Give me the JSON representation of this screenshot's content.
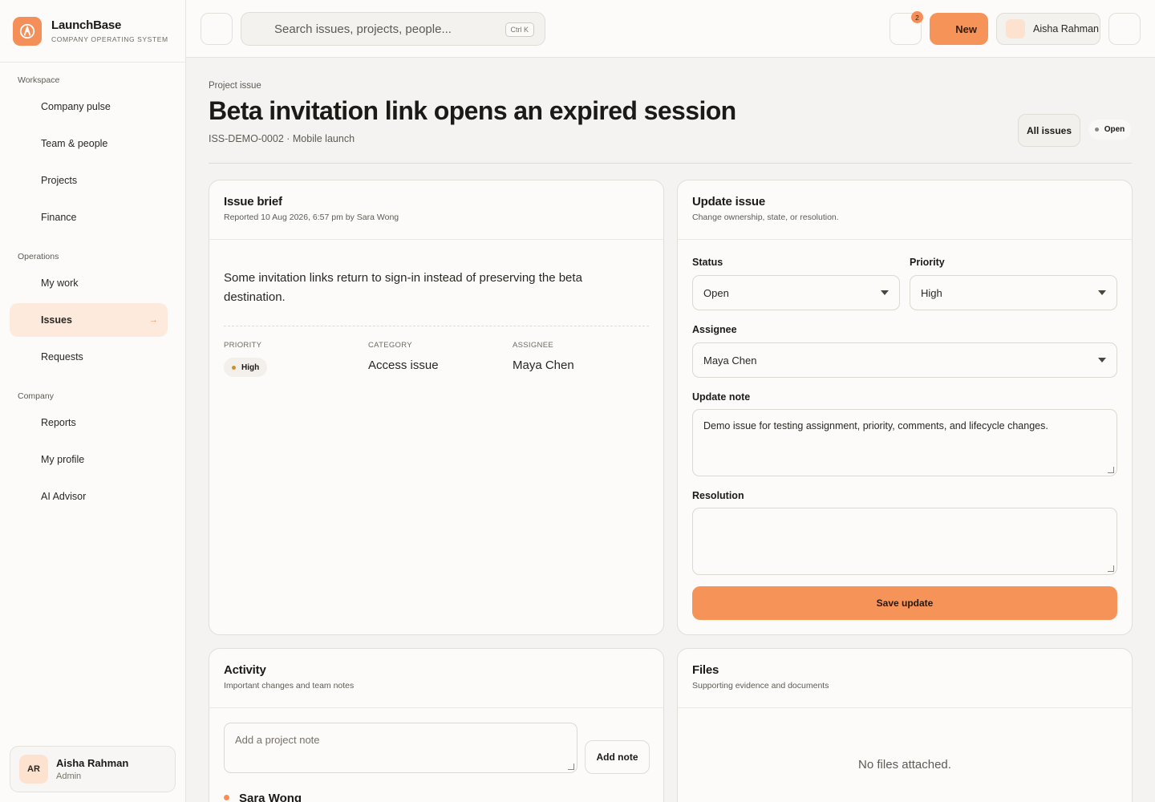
{
  "brand": {
    "name": "LaunchBase",
    "subtitle": "COMPANY OPERATING SYSTEM"
  },
  "sidebar": {
    "sections": [
      {
        "label": "Workspace",
        "items": [
          {
            "label": "Company pulse"
          },
          {
            "label": "Team & people"
          },
          {
            "label": "Projects"
          },
          {
            "label": "Finance"
          }
        ]
      },
      {
        "label": "Operations",
        "items": [
          {
            "label": "My work"
          },
          {
            "label": "Issues",
            "active": true,
            "arrow": "→"
          },
          {
            "label": "Requests"
          }
        ]
      },
      {
        "label": "Company",
        "items": [
          {
            "label": "Reports"
          },
          {
            "label": "My profile"
          },
          {
            "label": "AI Advisor"
          }
        ]
      }
    ],
    "user": {
      "initials": "AR",
      "name": "Aisha Rahman",
      "role": "Admin"
    }
  },
  "topbar": {
    "search_placeholder": "Search issues, projects, people...",
    "search_shortcut": "Ctrl K",
    "notification_count": "2",
    "new_label": "New",
    "user_name": "Aisha Rahman"
  },
  "page": {
    "eyebrow": "Project issue",
    "title": "Beta invitation link opens an expired session",
    "subtitle": "ISS-DEMO-0002 · Mobile launch",
    "all_issues_label": "All issues",
    "status": "Open"
  },
  "brief": {
    "title": "Issue brief",
    "subtitle": "Reported 10 Aug 2026, 6:57 pm by Sara Wong",
    "description": "Some invitation links return to sign-in instead of preserving the beta destination.",
    "priority_label": "PRIORITY",
    "priority": "High",
    "category_label": "CATEGORY",
    "category": "Access issue",
    "assignee_label": "ASSIGNEE",
    "assignee": "Maya Chen"
  },
  "update": {
    "title": "Update issue",
    "subtitle": "Change ownership, state, or resolution.",
    "status_label": "Status",
    "status_value": "Open",
    "priority_label": "Priority",
    "priority_value": "High",
    "assignee_label": "Assignee",
    "assignee_value": "Maya Chen",
    "note_label": "Update note",
    "note_value": "Demo issue for testing assignment, priority, comments, and lifecycle changes.",
    "resolution_label": "Resolution",
    "resolution_value": "",
    "save_label": "Save update"
  },
  "activity": {
    "title": "Activity",
    "subtitle": "Important changes and team notes",
    "note_placeholder": "Add a project note",
    "add_note_label": "Add note",
    "entries": [
      {
        "author": "Sara Wong"
      }
    ]
  },
  "files": {
    "title": "Files",
    "subtitle": "Supporting evidence and documents",
    "empty": "No files attached."
  },
  "colors": {
    "accent": "#f69358",
    "accent_soft": "#fdeadc",
    "priority_high": "#c9932a",
    "status_open": "#8a857e"
  }
}
